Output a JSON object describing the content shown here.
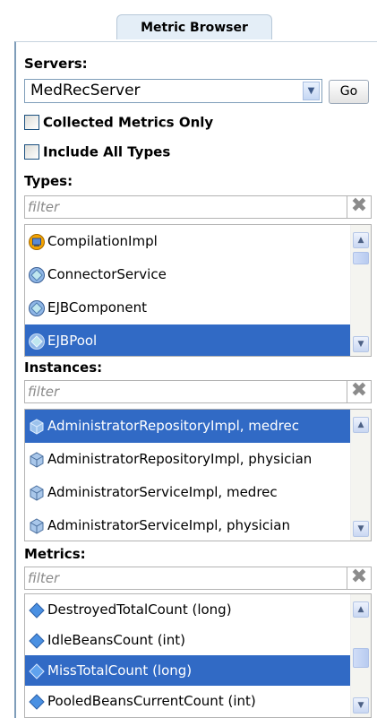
{
  "tab": {
    "label": "Metric Browser"
  },
  "servers": {
    "label": "Servers:",
    "selected": "MedRecServer",
    "go_label": "Go"
  },
  "options": {
    "collected_only": "Collected Metrics Only",
    "include_all_types": "Include All Types"
  },
  "types": {
    "label": "Types:",
    "filter_placeholder": "filter",
    "items": [
      {
        "label": "CompilationImpl",
        "icon": "compilation-icon"
      },
      {
        "label": "ConnectorService",
        "icon": "type-circle-icon"
      },
      {
        "label": "EJBComponent",
        "icon": "type-circle-icon"
      },
      {
        "label": "EJBPool",
        "icon": "type-circle-icon",
        "selected": true
      }
    ]
  },
  "instances": {
    "label": "Instances:",
    "filter_placeholder": "filter",
    "items": [
      {
        "label": "AdministratorRepositoryImpl, medrec",
        "selected": true
      },
      {
        "label": "AdministratorRepositoryImpl, physician"
      },
      {
        "label": "AdministratorServiceImpl, medrec"
      },
      {
        "label": "AdministratorServiceImpl, physician"
      }
    ]
  },
  "metrics": {
    "label": "Metrics:",
    "filter_placeholder": "filter",
    "items": [
      {
        "label": "DestroyedTotalCount (long)"
      },
      {
        "label": "IdleBeansCount (int)"
      },
      {
        "label": "MissTotalCount (long)",
        "selected": true
      },
      {
        "label": "PooledBeansCurrentCount (int)"
      }
    ]
  },
  "colors": {
    "selection": "#316ac5",
    "tab_bg": "#e4eef7"
  }
}
